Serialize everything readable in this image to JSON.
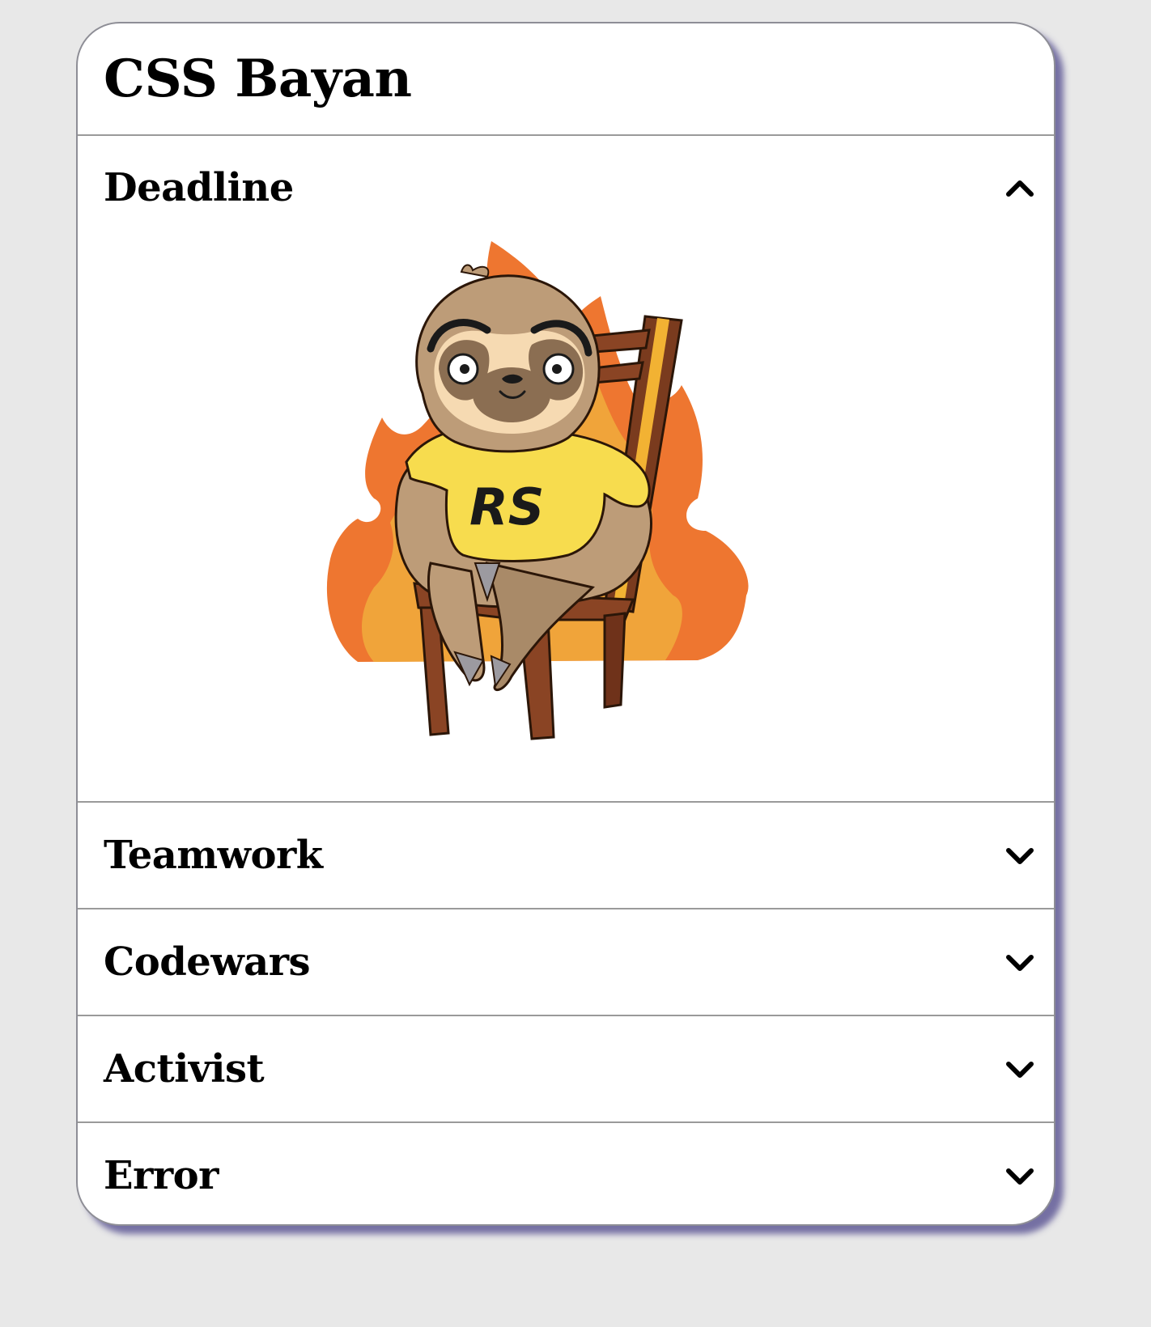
{
  "title": "CSS Bayan",
  "sections": [
    {
      "label": "Deadline",
      "expanded": true,
      "chevron": "chevron-up-icon",
      "image": "sloth-on-chair-in-fire",
      "shirt_text": "RS"
    },
    {
      "label": "Teamwork",
      "expanded": false,
      "chevron": "chevron-down-icon"
    },
    {
      "label": "Codewars",
      "expanded": false,
      "chevron": "chevron-down-icon"
    },
    {
      "label": "Activist",
      "expanded": false,
      "chevron": "chevron-down-icon"
    },
    {
      "label": "Error",
      "expanded": false,
      "chevron": "chevron-down-icon"
    }
  ],
  "colors": {
    "background": "#e8e8e8",
    "card": "#ffffff",
    "shadow": "#605a96",
    "flame_outer": "#ee7630",
    "flame_inner": "#f0a43a",
    "shirt": "#f7dc4e",
    "fur": "#bd9c78"
  }
}
